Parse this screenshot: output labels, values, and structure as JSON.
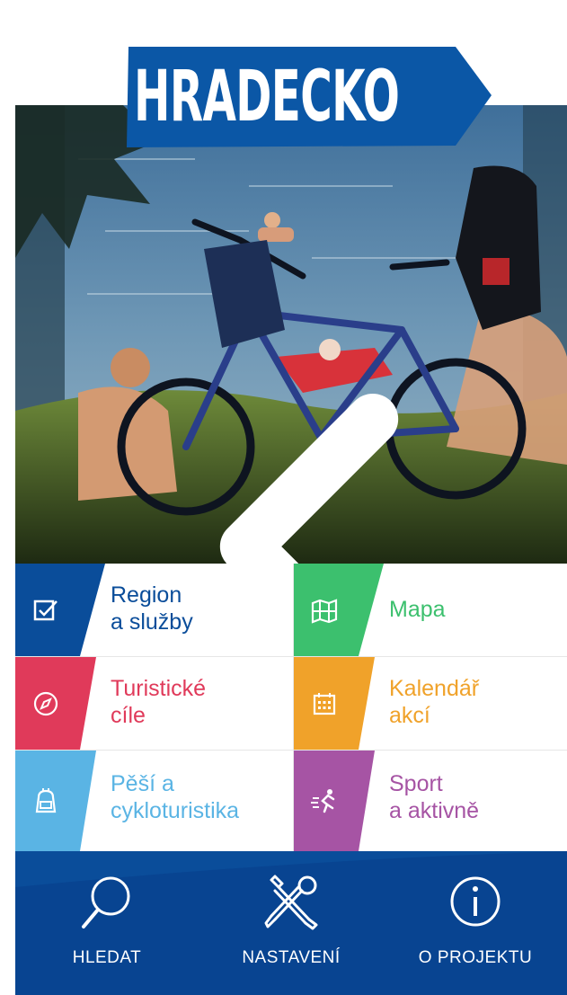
{
  "logo": {
    "text": "HRADECKO"
  },
  "carousel": {
    "prev": "previous-slide",
    "next": "next-slide"
  },
  "menu": {
    "tiles": [
      {
        "line1": "Region",
        "line2": "a služby",
        "icon": "checkbox-icon",
        "color": "#0a4d9a"
      },
      {
        "line1": "Mapa",
        "line2": "",
        "icon": "map-icon",
        "color": "#3cc06e"
      },
      {
        "line1": "Turistické",
        "line2": "cíle",
        "icon": "compass-icon",
        "color": "#e03a5a"
      },
      {
        "line1": "Kalendář",
        "line2": "akcí",
        "icon": "calendar-icon",
        "color": "#f0a22a"
      },
      {
        "line1": "Pěší a",
        "line2": "cykloturistika",
        "icon": "backpack-icon",
        "color": "#5ab4e4"
      },
      {
        "line1": "Sport",
        "line2": "a aktivně",
        "icon": "runner-icon",
        "color": "#a654a4"
      }
    ]
  },
  "bottom_bar": {
    "search_label": "HLEDAT",
    "settings_label": "NASTAVENÍ",
    "about_label": "O PROJEKTU"
  }
}
